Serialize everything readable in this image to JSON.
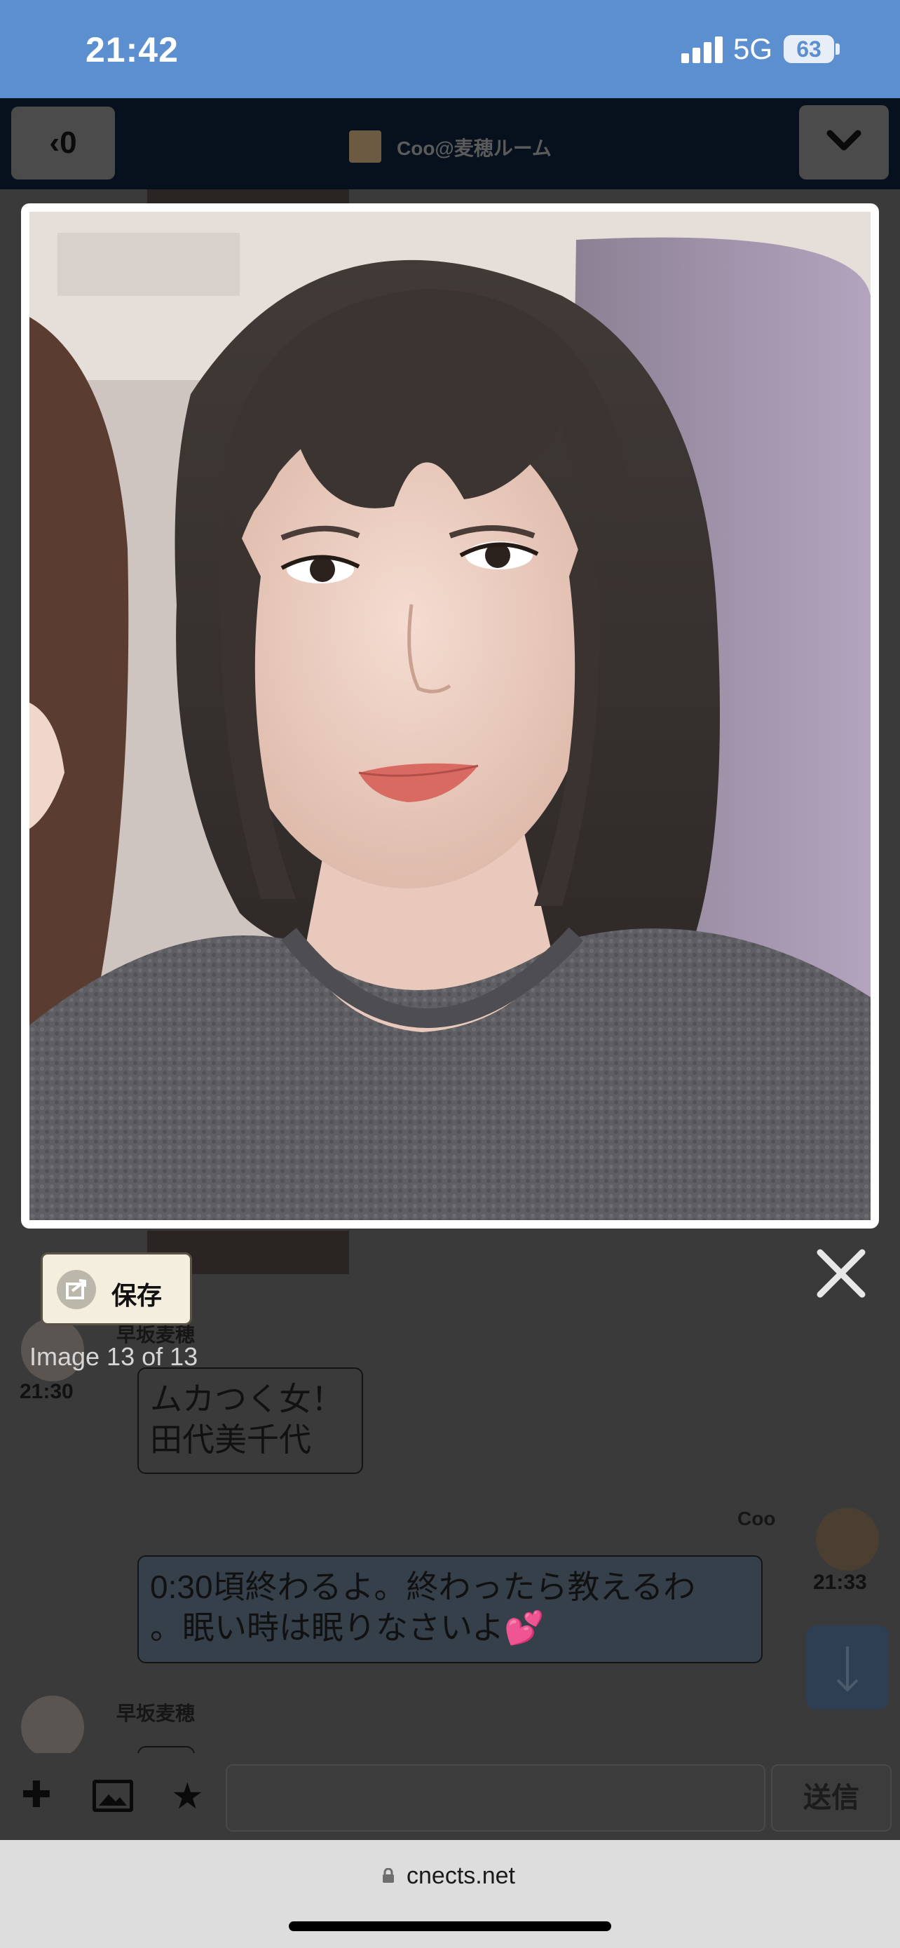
{
  "status_bar": {
    "time": "21:42",
    "network": "5G",
    "battery": "63"
  },
  "chat_header": {
    "back_label": "0",
    "room_title": "Coo@麦穂ルーム"
  },
  "messages": [
    {
      "sender": "早坂麦穂",
      "time": "21:30",
      "text_lines": [
        "ムカつく女！",
        "田代美千代"
      ]
    },
    {
      "sender": "Coo",
      "time": "21:33",
      "text_lines": [
        "0:30頃終わるよ。終わったら教えるわ",
        "。眠い時は眠りなさいよ💕"
      ]
    },
    {
      "sender": "早坂麦穂"
    }
  ],
  "input_bar": {
    "send_label": "送信"
  },
  "browser": {
    "url": "cnects.net"
  },
  "lightbox": {
    "save_label": "保存",
    "counter": "Image 13 of 13"
  }
}
